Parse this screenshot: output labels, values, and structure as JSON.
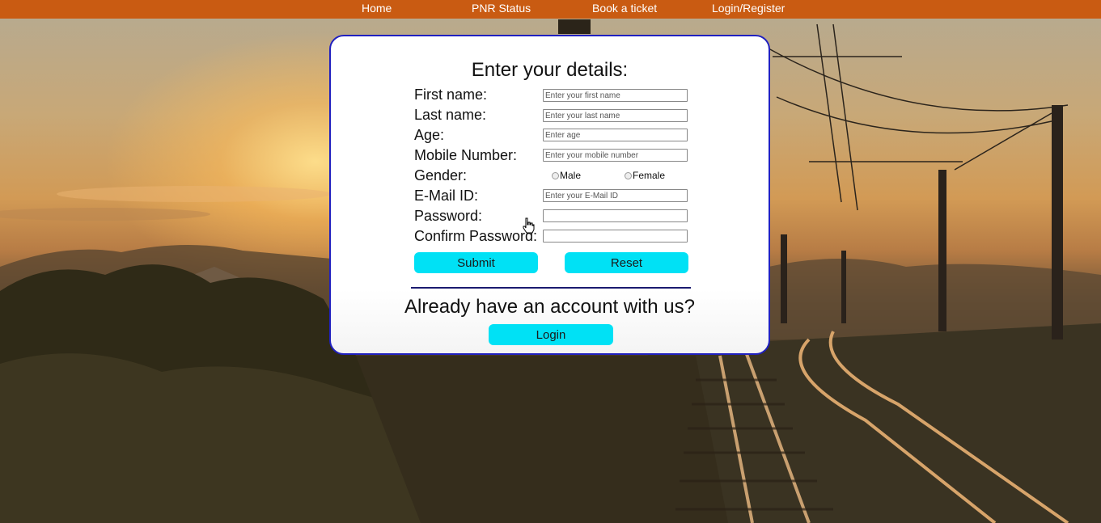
{
  "nav": {
    "items": [
      {
        "label": "Home"
      },
      {
        "label": "PNR Status"
      },
      {
        "label": "Book a ticket"
      },
      {
        "label": "Login/Register"
      }
    ]
  },
  "form": {
    "title": "Enter your details:",
    "fields": {
      "first_name": {
        "label": "First name:",
        "placeholder": "Enter your first name",
        "value": ""
      },
      "last_name": {
        "label": "Last name:",
        "placeholder": "Enter your last name",
        "value": ""
      },
      "age": {
        "label": "Age:",
        "placeholder": "Enter age",
        "value": ""
      },
      "mobile": {
        "label": "Mobile Number:",
        "placeholder": "Enter your mobile number",
        "value": ""
      },
      "gender": {
        "label": "Gender:",
        "options": [
          "Male",
          "Female"
        ]
      },
      "email": {
        "label": "E-Mail ID:",
        "placeholder": "Enter your E-Mail ID",
        "value": ""
      },
      "password": {
        "label": "Password:",
        "value": ""
      },
      "confirm_password": {
        "label": "Confirm Password:",
        "value": ""
      }
    },
    "submit_label": "Submit",
    "reset_label": "Reset",
    "already_text": "Already have an account with us?",
    "login_label": "Login"
  },
  "colors": {
    "nav_bg": "#c95b12",
    "button_bg": "#00e1f5",
    "card_border": "#2020c0"
  },
  "icons": {
    "cursor": "hand-pointer-icon"
  }
}
